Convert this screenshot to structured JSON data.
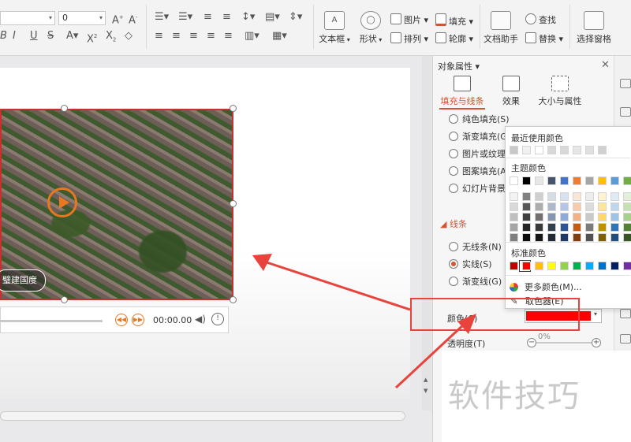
{
  "ribbon": {
    "font_size_value": "0",
    "font_grow_icon": "font-grow-icon",
    "font_shrink_icon": "font-shrink-icon",
    "format_icons": [
      "italic-icon",
      "underline-icon",
      "strikethrough-icon",
      "text-shadow-icon",
      "font-color-icon",
      "superscript-icon",
      "subscript-icon",
      "clear-format-icon"
    ],
    "textbox_label": "文本框",
    "shape_label": "形状",
    "picture_label": "图片",
    "arrange_label": "排列",
    "fill_label": "填充",
    "outline_label": "轮廓",
    "assistant_label": "文档助手",
    "find_label": "查找",
    "replace_label": "替换",
    "select_pane_label": "选择窗格",
    "textbox_icon_text": "A",
    "shape_icon_text": "◯"
  },
  "video": {
    "caption": "璧建国度",
    "time": "00:00.00"
  },
  "panel": {
    "title": "对象属性",
    "tabs": [
      {
        "label": "填充与线条"
      },
      {
        "label": "效果"
      },
      {
        "label": "大小与属性"
      }
    ],
    "fill_options": [
      {
        "label": "纯色填充(S)"
      },
      {
        "label": "渐变填充(G"
      },
      {
        "label": "图片或纹理"
      },
      {
        "label": "图案填充(A"
      },
      {
        "label": "幻灯片背景"
      }
    ],
    "line_section": "线条",
    "line_options": [
      {
        "label": "无线条(N)",
        "selected": false
      },
      {
        "label": "实线(S)",
        "selected": true
      },
      {
        "label": "渐变线(G)",
        "selected": false
      }
    ],
    "color_label": "颜色(C)",
    "color_value": "#ff0000",
    "transparency_label": "透明度(T)",
    "transparency_value": "0%"
  },
  "color_popup": {
    "recent_title": "最近使用颜色",
    "theme_title": "主题颜色",
    "standard_title": "标准颜色",
    "more_colors": "更多颜色(M)...",
    "eyedropper": "取色器(E)",
    "recent_colors": [
      "#c8c8c8",
      "#f0f0f0",
      "#ffffff",
      "#d8d8d8",
      "#d8d8d8",
      "#e6e6e6",
      "#e0e0e0",
      "#d0d0d0"
    ],
    "theme_top": [
      "#ffffff",
      "#000000",
      "#e7e6e6",
      "#44546a",
      "#4472c4",
      "#ed7d31",
      "#a5a5a5",
      "#ffc000",
      "#5b9bd5",
      "#70ad47"
    ],
    "theme_shades": [
      [
        "#f2f2f2",
        "#7f7f7f",
        "#d0cece",
        "#d6dce4",
        "#d9e2f3",
        "#fbe5d5",
        "#ededed",
        "#fff2cc",
        "#deebf6",
        "#e2efd9"
      ],
      [
        "#d8d8d8",
        "#595959",
        "#aeabab",
        "#adb9ca",
        "#b4c6e7",
        "#f7cbac",
        "#dbdbdb",
        "#fee599",
        "#bdd7ee",
        "#c5e0b3"
      ],
      [
        "#bfbfbf",
        "#3f3f3f",
        "#757070",
        "#8496b0",
        "#8eaadb",
        "#f4b183",
        "#c9c9c9",
        "#ffd965",
        "#9dc3e6",
        "#a8d08d"
      ],
      [
        "#a5a5a5",
        "#262626",
        "#3a3838",
        "#323f4f",
        "#2f5496",
        "#c55a11",
        "#7b7b7b",
        "#bf9000",
        "#2e75b5",
        "#538135"
      ],
      [
        "#7f7f7f",
        "#0c0c0c",
        "#171616",
        "#222a35",
        "#1f3864",
        "#833c0b",
        "#525252",
        "#7f6000",
        "#1e4e79",
        "#375623"
      ]
    ],
    "standard_colors": [
      "#c00000",
      "#ff0000",
      "#ffc000",
      "#ffff00",
      "#92d050",
      "#00b050",
      "#00b0f0",
      "#0070c0",
      "#002060",
      "#7030a0"
    ]
  },
  "watermark": "软件技巧",
  "colors": {
    "accent": "#d6542d",
    "annotation_red": "#e8433c",
    "video_border": "#c8302c"
  }
}
